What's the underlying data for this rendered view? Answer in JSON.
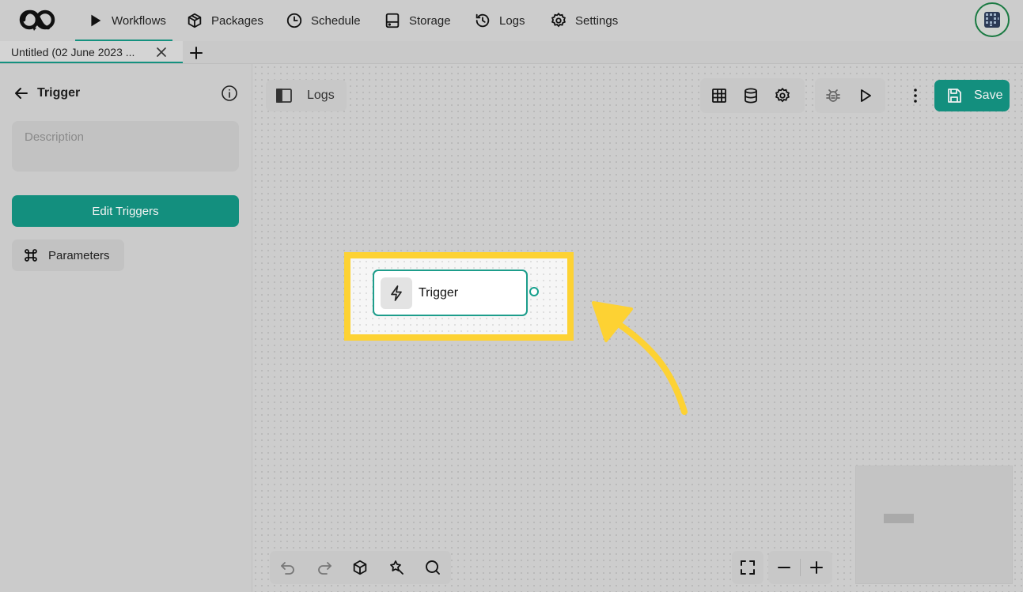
{
  "nav": {
    "items": [
      {
        "label": "Workflows",
        "icon": "play-icon",
        "active": true
      },
      {
        "label": "Packages",
        "icon": "package-icon"
      },
      {
        "label": "Schedule",
        "icon": "clock-icon"
      },
      {
        "label": "Storage",
        "icon": "storage-icon"
      },
      {
        "label": "Logs",
        "icon": "history-icon"
      },
      {
        "label": "Settings",
        "icon": "gear-icon"
      }
    ]
  },
  "tabs": [
    {
      "title": "Untitled (02 June 2023 ..."
    }
  ],
  "panel": {
    "title": "Trigger",
    "description_placeholder": "Description",
    "edit_button": "Edit Triggers",
    "parameters_button": "Parameters"
  },
  "canvas": {
    "logs_button": "Logs",
    "save_button": "Save",
    "node": {
      "label": "Trigger",
      "icon": "lightning-icon"
    }
  },
  "colors": {
    "accent": "#138f7e",
    "highlight": "#fdd233",
    "node_border": "#1d9d8b"
  }
}
